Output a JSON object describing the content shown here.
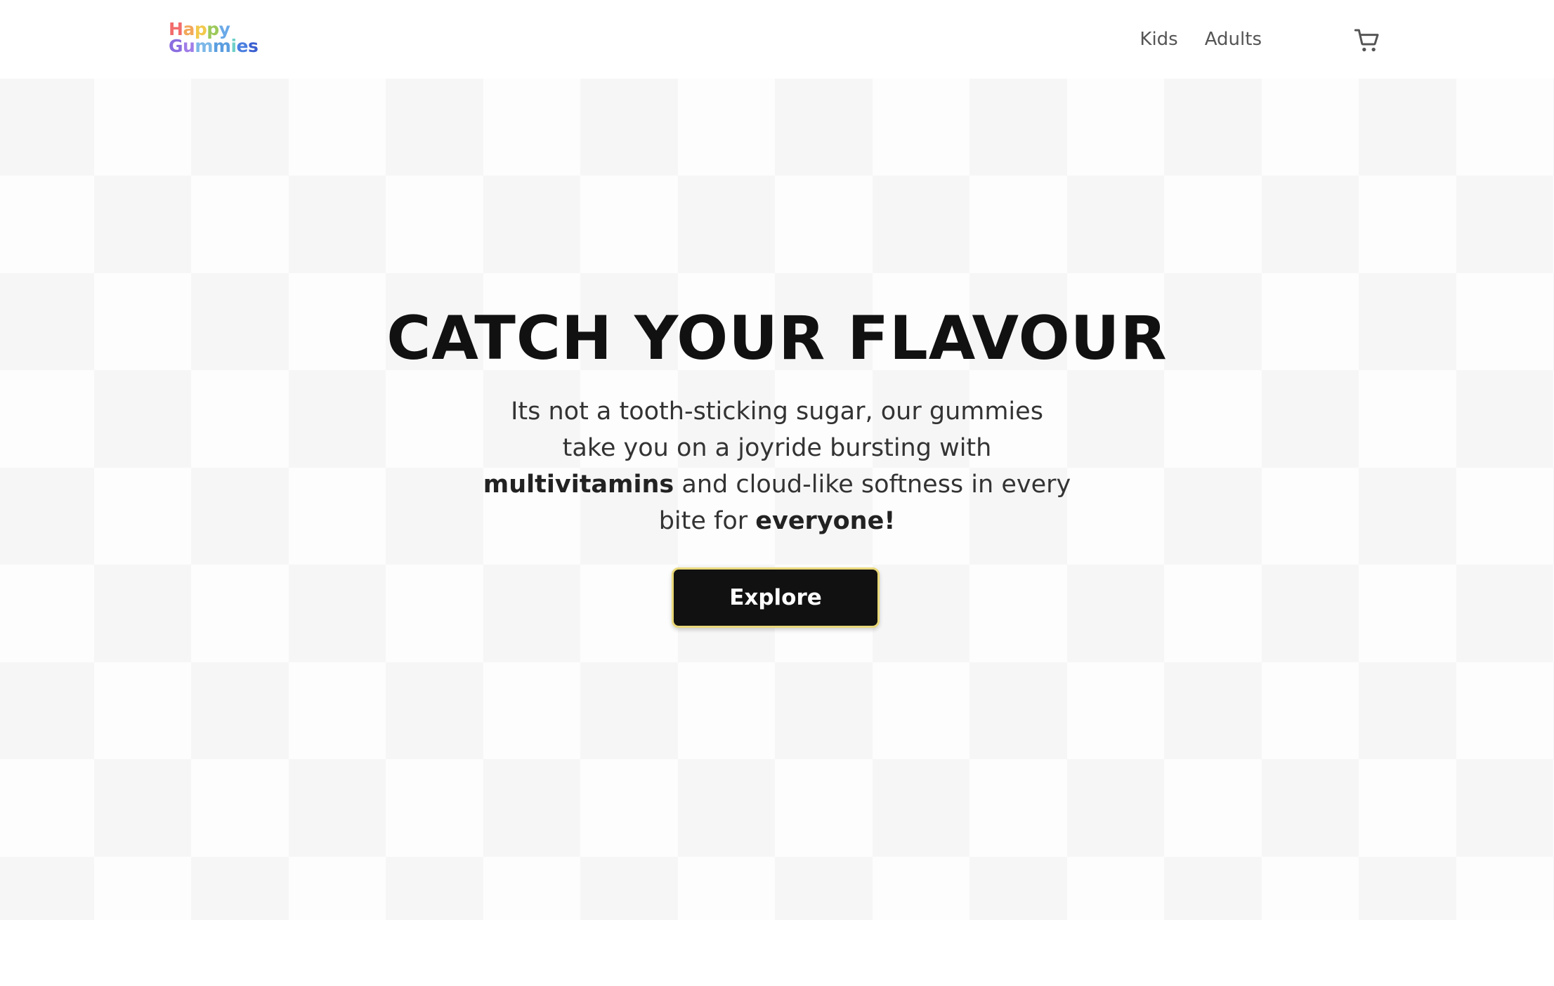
{
  "brand": {
    "logo_line1": [
      "H",
      "a",
      "p",
      "p",
      "y"
    ],
    "logo_line2": [
      "G",
      "u",
      "m",
      "m",
      "i",
      "e",
      "s"
    ],
    "logo_colors_line1": [
      "#f26c6c",
      "#f2a85a",
      "#f2c94c",
      "#9cc95a",
      "#6aa9e8"
    ],
    "logo_colors_line2": [
      "#8a6ee0",
      "#a07de8",
      "#7bb8e8",
      "#5a9de0",
      "#6fd0c8",
      "#4a7fe0",
      "#3a5fd0"
    ]
  },
  "nav": {
    "items": [
      "Kids",
      "Adults"
    ],
    "cart_icon": "shopping-cart-icon"
  },
  "hero": {
    "title": "CATCH YOUR FLAVOUR",
    "text_part1": "Its not a tooth-sticking sugar, our gummies take you on a joyride bursting with ",
    "text_bold1": "multivitamins",
    "text_part2": " and cloud-like softness in every bite for ",
    "text_bold2": "everyone!",
    "button_label": "Explore"
  },
  "colors": {
    "button_bg": "#111111",
    "button_border": "#e9d87a",
    "text_dark": "#111111",
    "nav_text": "#555555"
  }
}
